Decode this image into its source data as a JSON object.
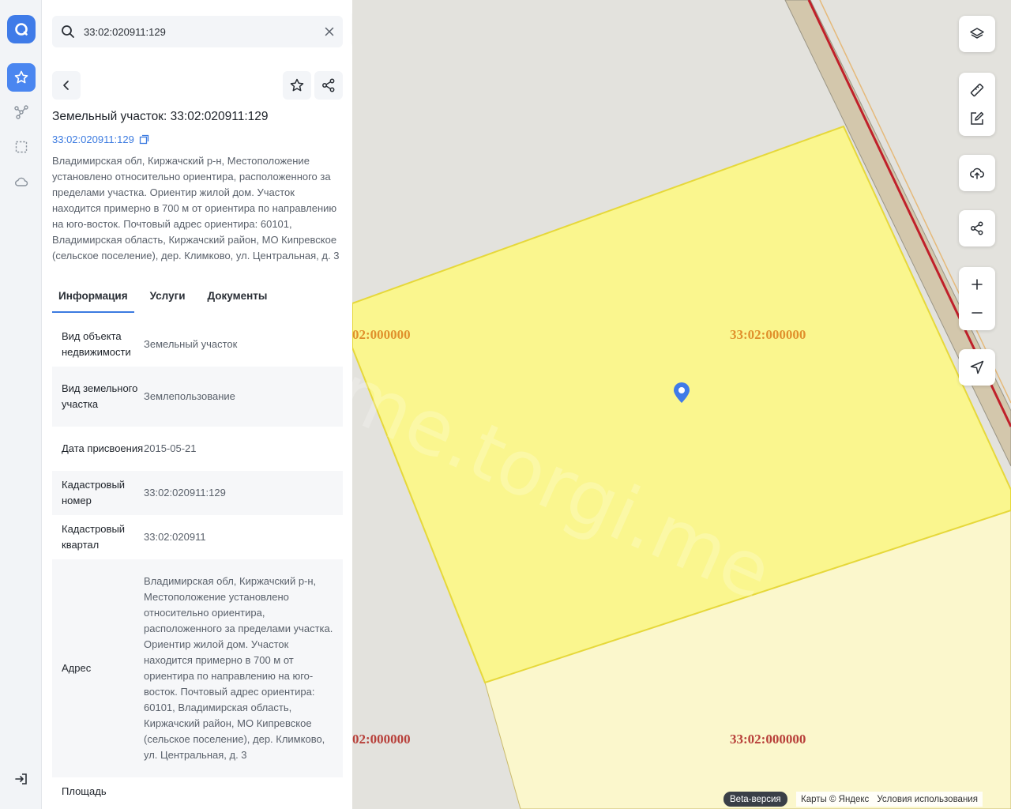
{
  "search": {
    "value": "33:02:020911:129"
  },
  "header": {
    "title": "Земельный участок: 33:02:020911:129",
    "cadastral_link": "33:02:020911:129"
  },
  "description": "Владимирская обл, Киржачский р-н, Местоположение установлено относительно ориентира, расположенного за пределами участка. Ориентир жилой дом. Участок находится примерно в 700 м от ориентира по направлению на юго-восток. Почтовый адрес ориентира: 60101, Владимирская область, Киржачский район, МО Кипревское (сельское поселение), дер. Климково, ул. Центральная, д. 3",
  "tabs": [
    "Информация",
    "Услуги",
    "Документы"
  ],
  "properties": [
    {
      "key": "Вид объекта недвижимости",
      "value": "Земельный участок"
    },
    {
      "key": "Вид земельного участка",
      "value": "Землепользование"
    },
    {
      "key": "Дата присвоения",
      "value": "2015-05-21"
    },
    {
      "key": "Кадастровый номер",
      "value": "33:02:020911:129"
    },
    {
      "key": "Кадастровый квартал",
      "value": "33:02:020911"
    },
    {
      "key": "Адрес",
      "value": "Владимирская обл, Киржачский р-н, Местоположение установлено относительно ориентира, расположенного за пределами участка. Ориентир жилой дом. Участок находится примерно в 700 м от ориентира по направлению на юго-восток. Почтовый адрес ориентира: 60101, Владимирская область, Киржачский район, МО Кипревское (сельское поселение), дер. Климково, ул. Центральная, д. 3"
    },
    {
      "key": "Площадь",
      "value": ""
    }
  ],
  "map": {
    "labels": {
      "top_left": "02:000000",
      "top_right": "33:02:000000",
      "bottom_left": "02:000000",
      "bottom_right": "33:02:000000"
    },
    "watermark": "me.torgi.me",
    "attribution": {
      "beta": "Beta-версия",
      "maps": "Карты © Яндекс",
      "terms": "Условия использования"
    }
  },
  "colors": {
    "accent": "#3f7be8",
    "parcel_selected": "#faf68e",
    "parcel_other": "#fbf7cc",
    "road": "#d3c7ac",
    "rail": "#c0202a"
  }
}
